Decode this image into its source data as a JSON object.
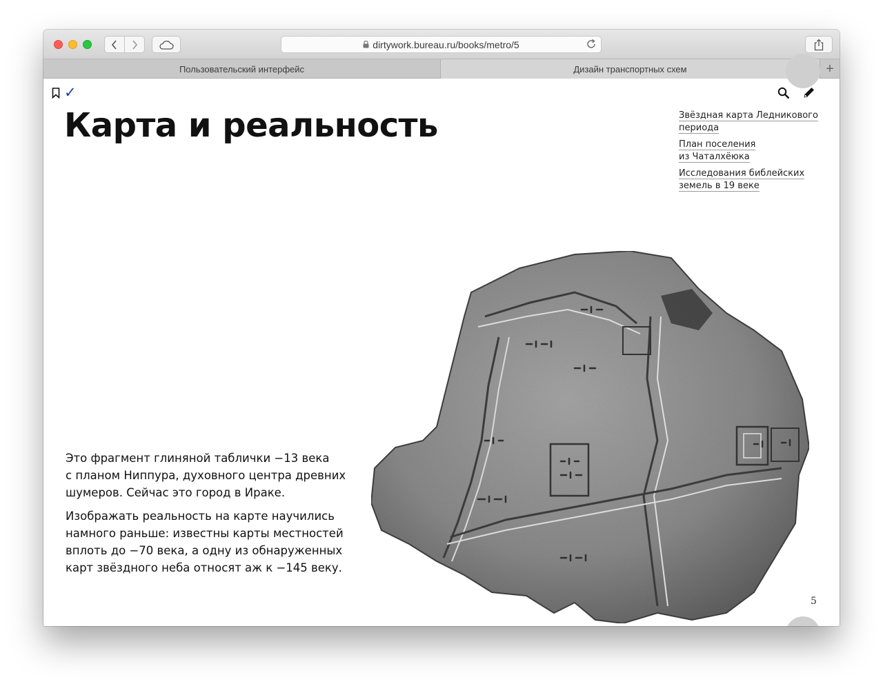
{
  "browser": {
    "url": "dirtywork.bureau.ru/books/metro/5",
    "tabs": [
      {
        "label": "Пользовательский интерфейс",
        "active": false
      },
      {
        "label": "Дизайн транспортных схем",
        "active": true
      }
    ],
    "new_tab_label": "+"
  },
  "page": {
    "check_mark": "✓",
    "title": "Карта и реальность",
    "related_links": [
      {
        "line1": "Звёздная карта Ледникового",
        "line2": "периода"
      },
      {
        "line1": "План поселения",
        "line2": "из Чаталхёюка"
      },
      {
        "line1": "Исследования библейских",
        "line2": "земель в 19 веке"
      }
    ],
    "paragraphs": [
      {
        "lines": [
          "Это фрагмент глиняной таблички −13 века",
          "с планом Ниппура, духовного центра древних",
          "шумеров. Сейчас это город в Ираке."
        ]
      },
      {
        "lines": [
          "Изображать реальность на карте научились",
          "намного раньше: известны карты местностей",
          "вплоть до −70 века, а одну из обнаруженных",
          "карт звёздного неба относят аж к −145 веку."
        ]
      }
    ],
    "page_number": "5"
  },
  "colors": {
    "accent_check": "#1f3da8",
    "traffic_red": "#fd5f57",
    "traffic_yellow": "#febb2e",
    "traffic_green": "#28c840"
  }
}
